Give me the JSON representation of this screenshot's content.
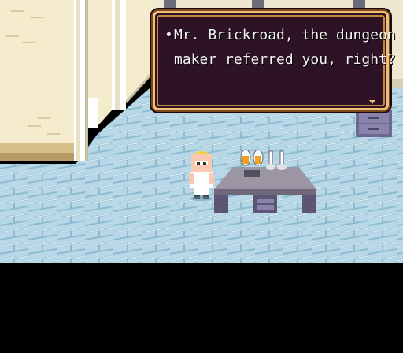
{
  "game": {
    "dialog": {
      "line1_bullet": "•",
      "line1_text": "Mr. Brickroad, the dungeon",
      "line2_text": "maker referred you, right?"
    },
    "colors": {
      "dialog_border": "#f0c07a",
      "dialog_background": "#2e1226",
      "dialog_text": "#f4f4f4",
      "floor_light": "#b8d8e8",
      "floor_dark": "#7fb0c8",
      "wall": "#f5eccd",
      "table_top": "#9c96a4",
      "letterbox": "#000000"
    },
    "icons": {
      "player": "player-character-sprite",
      "continue": "dialog-continue-arrow-icon"
    }
  }
}
